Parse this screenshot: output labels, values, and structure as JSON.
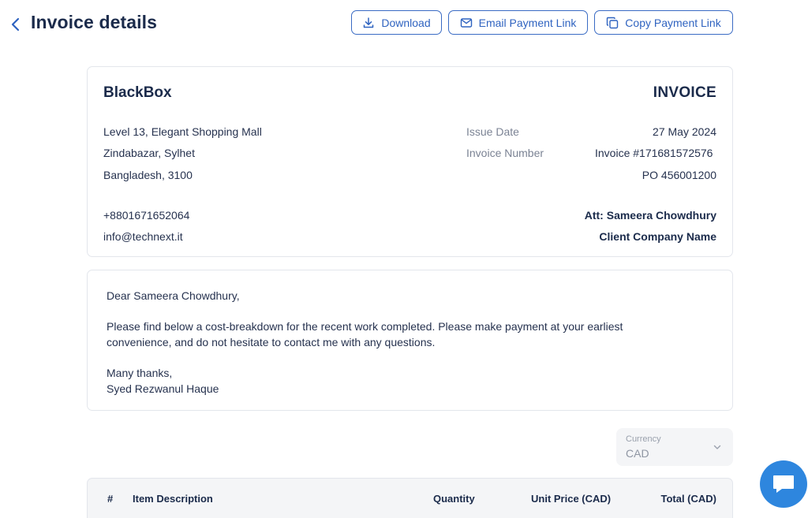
{
  "header": {
    "title": "Invoice details",
    "buttons": {
      "download": "Download",
      "email": "Email Payment Link",
      "copy": "Copy Payment Link"
    }
  },
  "invoice": {
    "company": "BlackBox",
    "heading": "INVOICE",
    "address": [
      "Level 13, Elegant Shopping Mall",
      "Zindabazar, Sylhet",
      "Bangladesh, 3100"
    ],
    "phone": "+8801671652064",
    "email": "info@technext.it",
    "issue_date_label": "Issue Date",
    "issue_date": "27 May 2024",
    "invoice_number_label": "Invoice Number",
    "invoice_number": "Invoice #171681572576",
    "po": "PO 456001200",
    "attention": "Att: Sameera Chowdhury",
    "client_company": "Client Company Name"
  },
  "letter": {
    "greeting": "Dear Sameera Chowdhury,",
    "body": "Please find below a cost-breakdown for the recent work completed. Please make payment at your earliest convenience, and do not hesitate to contact me with any questions.",
    "closing": "Many thanks,",
    "signature": "Syed Rezwanul Haque"
  },
  "currency": {
    "label": "Currency",
    "value": "CAD"
  },
  "table": {
    "headers": [
      "#",
      "Item Description",
      "Quantity",
      "Unit Price (CAD)",
      "Total (CAD)"
    ]
  },
  "colors": {
    "accent": "#2f63c0",
    "title": "#1b2b4b",
    "chat": "#2e86de"
  },
  "icons": {
    "back": "chevron-left-icon",
    "download": "download-icon",
    "email": "mail-icon",
    "copy": "copy-icon",
    "currency": "chevron-down-icon",
    "chat": "chat-bubble-icon"
  }
}
